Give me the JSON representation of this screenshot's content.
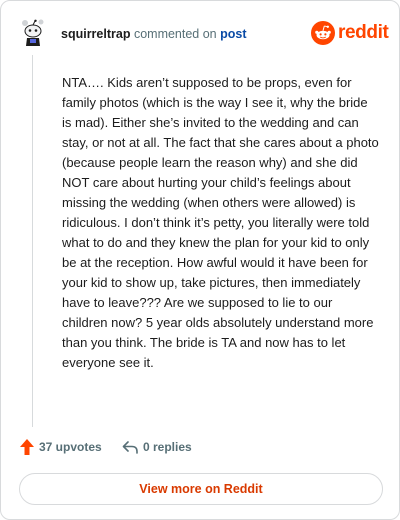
{
  "header": {
    "username": "squirreltrap",
    "commented_on": "commented on",
    "post_link": "post",
    "brand_name": "reddit"
  },
  "comment": {
    "body": "NTA…. Kids aren’t supposed to be props, even for family photos (which is the way I see it, why the bride is mad). Either she’s invited to the wedding and can stay, or not at all. The fact that she cares about a photo (because people learn the reason why) and she did NOT care about hurting your child’s feelings about missing the wedding (when others were allowed) is ridiculous. I don’t think it’s petty, you literally were told what to do and they knew the plan for your kid to only be at the reception. How awful would it have been for your kid to show up, take pictures, then immediately have to leave??? Are we supposed to lie to our children now? 5 year olds absolutely understand more than you think. The bride is TA and now has to let everyone see it."
  },
  "actions": {
    "upvotes": "37 upvotes",
    "replies": "0 replies"
  },
  "footer": {
    "view_more": "View more on Reddit"
  },
  "colors": {
    "brand": "#ff4500",
    "link": "#0a4ba6",
    "muted": "#576f76",
    "view_more": "#d93a00"
  },
  "icons": {
    "avatar": "snoo-avatar-icon",
    "brand": "reddit-logo-icon",
    "upvote": "upvote-arrow-icon",
    "reply": "reply-arrow-icon"
  }
}
